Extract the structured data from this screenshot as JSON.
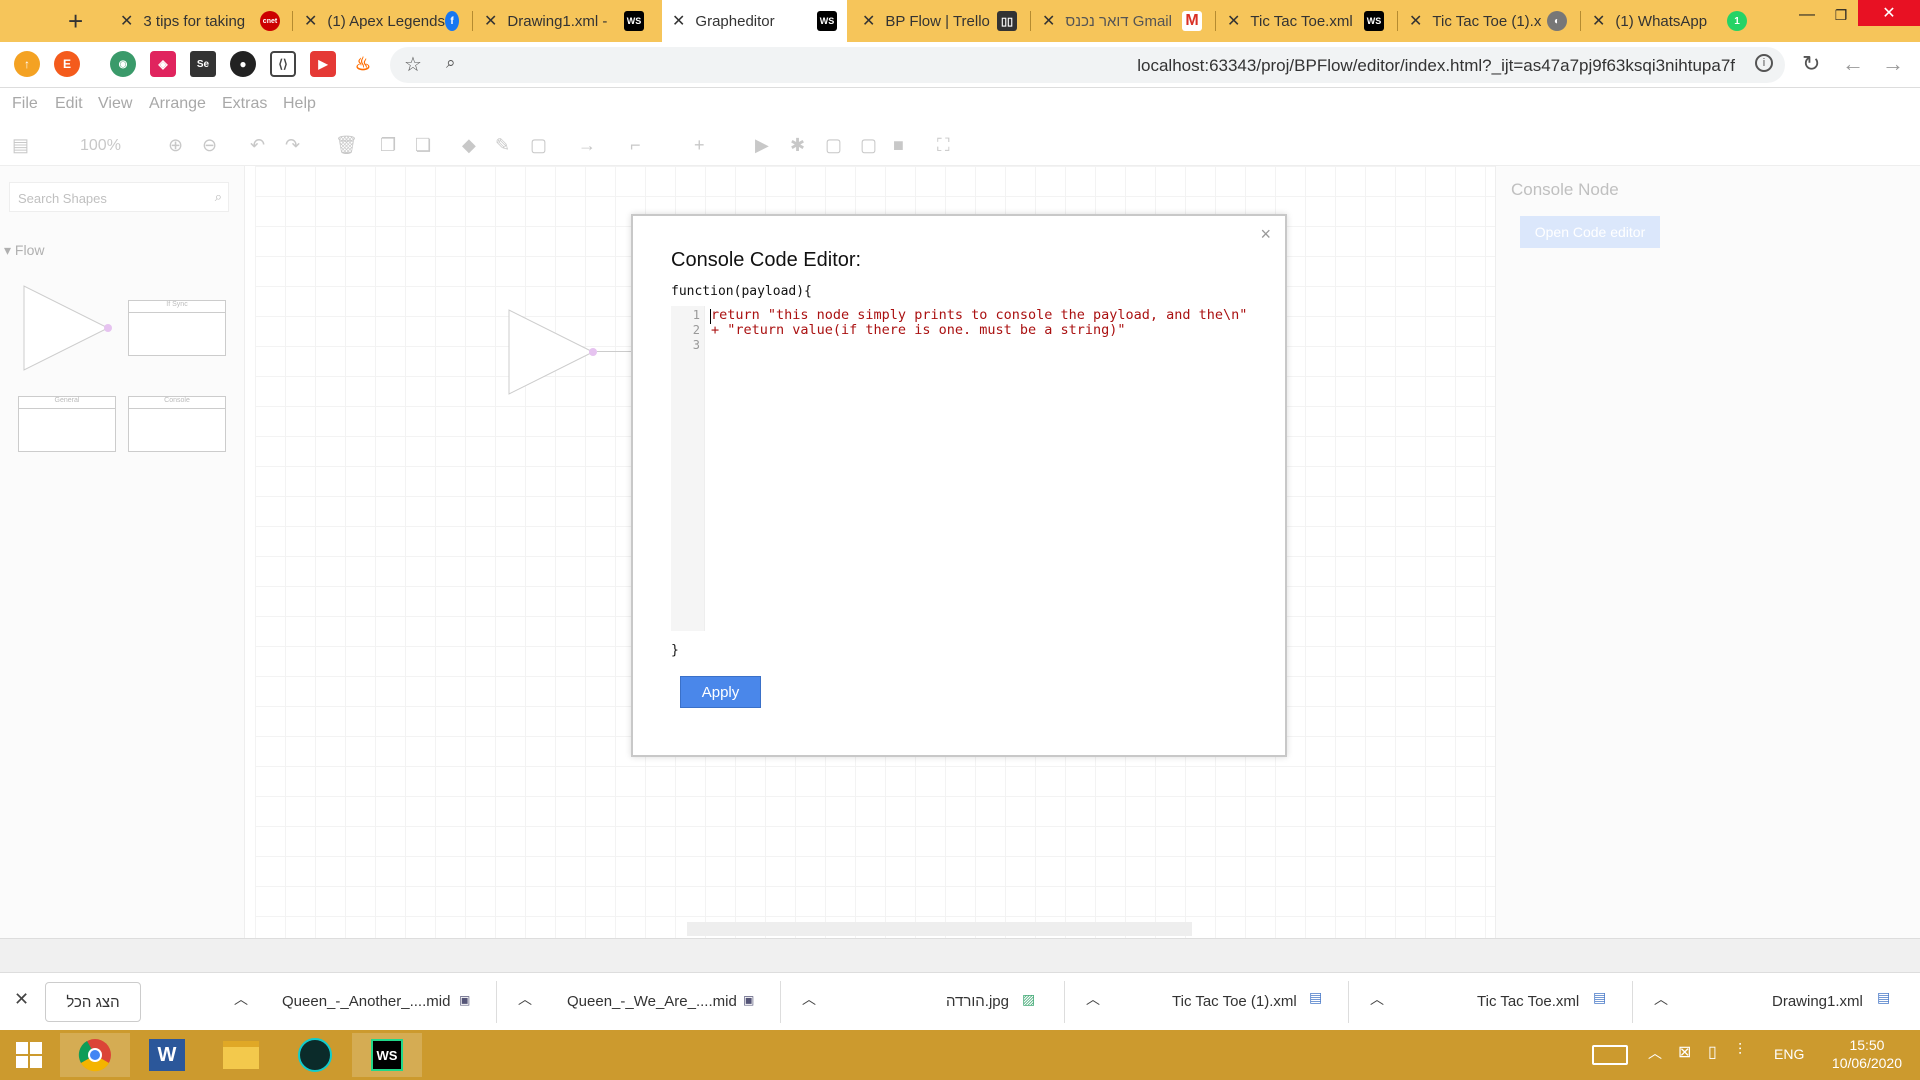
{
  "browser": {
    "new_tab_label": "+",
    "tabs": [
      {
        "title": "3 tips for taking",
        "favicon": "cnet-icon",
        "active": false
      },
      {
        "title": "(1) Apex Legends",
        "favicon": "facebook-icon",
        "active": false
      },
      {
        "title": "Drawing1.xml -",
        "favicon": "webstorm-icon",
        "active": false
      },
      {
        "title": "Grapheditor",
        "favicon": "webstorm-icon",
        "active": true
      },
      {
        "title": "BP Flow | Trello",
        "favicon": "trello-icon",
        "active": false
      },
      {
        "title": "דואר נכנס Gmail",
        "favicon": "gmail-icon",
        "active": false
      },
      {
        "title": "Tic Tac Toe.xml",
        "favicon": "webstorm-icon",
        "active": false
      },
      {
        "title": "Tic Tac Toe (1).x",
        "favicon": "globe-icon",
        "active": false
      },
      {
        "title": "(1) WhatsApp",
        "favicon": "whatsapp-icon",
        "active": false
      }
    ],
    "whatsapp_badge": "1",
    "url": "localhost:63343/proj/BPFlow/editor/index.html?_ijt=as47a7pj9f63ksqi3nihtupa7f",
    "extensions": [
      "E",
      "Se"
    ]
  },
  "app": {
    "menu": [
      "File",
      "Edit",
      "View",
      "Arrange",
      "Extras",
      "Help"
    ],
    "zoom": "100%",
    "search_placeholder": "Search Shapes",
    "palette_section": "Flow",
    "shape_labels": [
      "If Sync",
      "General",
      "Console"
    ],
    "right_panel_title": "Console Node",
    "right_panel_button": "Open Code editor"
  },
  "dialog": {
    "title": "Console Code Editor:",
    "close": "×",
    "fn_open": "function(payload){",
    "fn_close": "}",
    "line_numbers": [
      "1",
      "2",
      "3"
    ],
    "code_lines": [
      "return \"this node simply prints to console the payload, and the\\n\"",
      "+ \"return value(if there is one. must be a string)\"",
      ""
    ],
    "apply_label": "Apply"
  },
  "downloads": {
    "show_all": "הצג הכל",
    "items": [
      "Queen_-_Another_....mid",
      "Queen_-_We_Are_....mid",
      "הורדה.jpg",
      "Tic Tac Toe (1).xml",
      "Tic Tac Toe.xml",
      "Drawing1.xml"
    ]
  },
  "taskbar": {
    "lang": "ENG",
    "time": "15:50",
    "date": "10/06/2020"
  },
  "colors": {
    "tabstrip": "#f6c55a",
    "taskbar": "#cc9a2e",
    "apply": "#4a87ea",
    "code_string": "#aa1111"
  }
}
